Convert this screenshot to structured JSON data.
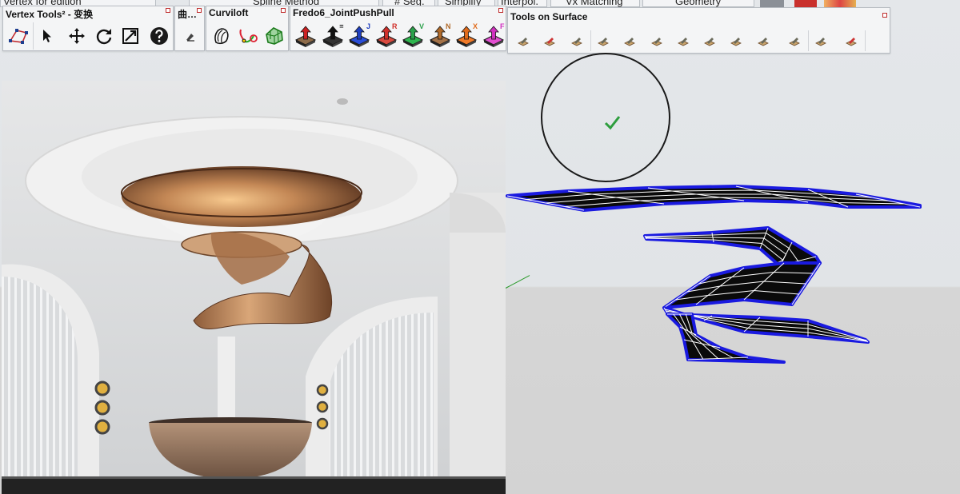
{
  "top_tabs": [
    "Vertex for edition",
    "Spline Method",
    "# Seg.",
    "Simplify",
    "Interpol.",
    "Vx Matching",
    "Geometry"
  ],
  "toolbars": {
    "vertex_tools": {
      "title": "Vertex Tools² - 变换",
      "buttons": [
        "vertex-select-tool",
        "select-arrow",
        "move",
        "rotate",
        "scale",
        "help"
      ]
    },
    "curve_tools": {
      "title": "曲…",
      "buttons": [
        "curve-tool"
      ]
    },
    "curviloft": {
      "title": "Curviloft",
      "buttons": [
        "loft-by-spline",
        "skin-contours",
        "loft-along-path"
      ]
    },
    "joint_push_pull": {
      "title": "Fredo6_JointPushPull",
      "buttons": [
        {
          "name": "joint-push-pull",
          "letter": ""
        },
        {
          "name": "vector-push-pull",
          "letter": "="
        },
        {
          "name": "normal-push-pull",
          "letter": "J"
        },
        {
          "name": "round-push-pull",
          "letter": "R"
        },
        {
          "name": "vertex-push-pull",
          "letter": "V"
        },
        {
          "name": "normal-axis-push-pull",
          "letter": "N"
        },
        {
          "name": "extrude-push-pull",
          "letter": "X"
        },
        {
          "name": "follow-push-pull",
          "letter": "F"
        }
      ]
    },
    "tools_on_surface": {
      "title": "Tools on Surface",
      "buttons": [
        "tos-line",
        "tos-pen",
        "tos-rectangle",
        "tos-circle",
        "tos-polygon",
        "tos-ellipse",
        "tos-parallelogram",
        "tos-arc",
        "tos-offset",
        "tos-make-face",
        "tos-generate-faces",
        "tos-eraser",
        "tos-edit"
      ]
    }
  },
  "colors": {
    "ribbon_edge": "#1a1ae0",
    "ribbon_fill": "#0a0a0a",
    "check": "#2e9e3e",
    "bronze": "#b4825a"
  }
}
